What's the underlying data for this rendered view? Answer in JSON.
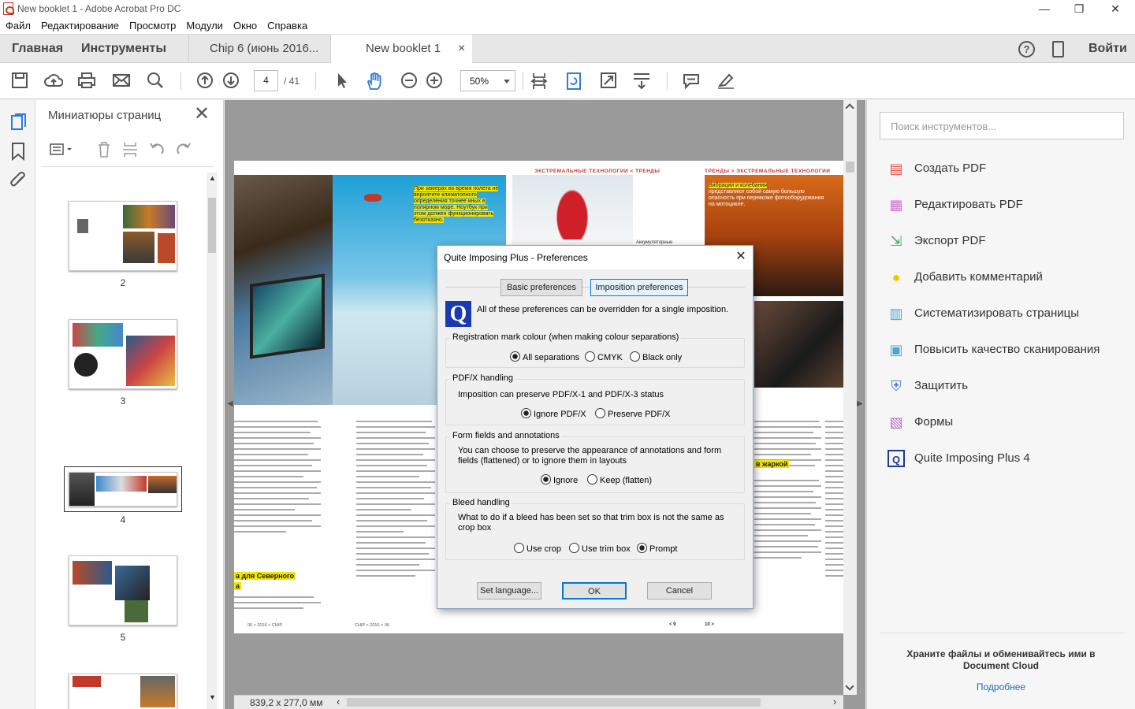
{
  "window": {
    "title": "New booklet 1 - Adobe Acrobat Pro DC",
    "controls": [
      "—",
      "❐",
      "✕"
    ]
  },
  "menu": [
    "Файл",
    "Редактирование",
    "Просмотр",
    "Модули",
    "Окно",
    "Справка"
  ],
  "tabs": {
    "home": "Главная",
    "tools": "Инструменты",
    "doc1": "Chip 6 (июнь 2016...",
    "doc2": "New booklet 1",
    "doc2_close": "×",
    "signin": "Войти"
  },
  "toolbar": {
    "page_current": "4",
    "page_total": "/ 41",
    "zoom": "50%"
  },
  "thumbs": {
    "title": "Миниатюры страниц",
    "pages": [
      "2",
      "3",
      "4",
      "5"
    ]
  },
  "document": {
    "header_left": "ЭКСТРЕМАЛЬНЫЕ ТЕХНОЛОГИИ < ТРЕНДЫ",
    "header_right": "ТРЕНДЫ > ЭКСТРЕМАЛЬНЫЕ ТЕХНОЛОГИИ",
    "caption1": "При замерах во время полета не вероятите климатопного определения точнее иных в полярном море. Ноутбук при этом должен функционировать безотказно.",
    "caption2": "Вибрации и колебания",
    "caption2_sub": "представляют собой самую большую опасность при перевозке фотооборудования на мотоцикле.",
    "label_small": "Аккумуляторные",
    "heading_left": "а для Северного",
    "heading_left2": "а",
    "heading_right": "в жаркой",
    "footer_left": "06 > 2016 > CHIP",
    "footer_mid": "CHIP < 2016 < 06",
    "footer_p9": "< 9",
    "footer_p10": "10 >",
    "size": "839,2 x 277,0 мм"
  },
  "dialog": {
    "title": "Quite Imposing Plus - Preferences",
    "tab_basic": "Basic preferences",
    "tab_imposition": "Imposition preferences",
    "intro": "All of these preferences can be overridden for a single imposition.",
    "logo": "Q",
    "reg_label": "Registration mark colour (when making colour separations)",
    "reg_all": "All separations",
    "reg_cmyk": "CMYK",
    "reg_black": "Black only",
    "pdfx_label": "PDF/X handling",
    "pdfx_text": "Imposition can preserve PDF/X-1 and PDF/X-3 status",
    "pdfx_ignore": "Ignore PDF/X",
    "pdfx_preserve": "Preserve PDF/X",
    "form_label": "Form fields and annotations",
    "form_text": "You can choose to preserve the appearance of annotations and form fields (flattened) or to ignore them in layouts",
    "form_ignore": "Ignore",
    "form_keep": "Keep (flatten)",
    "bleed_label": "Bleed handling",
    "bleed_text": "What to do if a bleed has been set so that trim box is not the same as crop box",
    "bleed_crop": "Use crop",
    "bleed_trim": "Use trim box",
    "bleed_prompt": "Prompt",
    "btn_language": "Set language...",
    "btn_ok": "OK",
    "btn_cancel": "Cancel"
  },
  "rightpane": {
    "search_placeholder": "Поиск инструментов...",
    "tools": [
      {
        "label": "Создать PDF",
        "color": "#e2574c"
      },
      {
        "label": "Редактировать PDF",
        "color": "#d36ad0"
      },
      {
        "label": "Экспорт PDF",
        "color": "#3fa86b"
      },
      {
        "label": "Добавить комментарий",
        "color": "#f5c400"
      },
      {
        "label": "Систематизировать страницы",
        "color": "#4aa3d6"
      },
      {
        "label": "Повысить качество сканирования",
        "color": "#4aa3d6"
      },
      {
        "label": "Защитить",
        "color": "#4a7fd6"
      },
      {
        "label": "Формы",
        "color": "#b86bc4"
      },
      {
        "label": "Quite Imposing Plus 4",
        "color": "#1a3a9a"
      }
    ],
    "cloud_text": "Храните файлы и обменивайтесь ими в Document Cloud",
    "cloud_link": "Подробнее"
  }
}
